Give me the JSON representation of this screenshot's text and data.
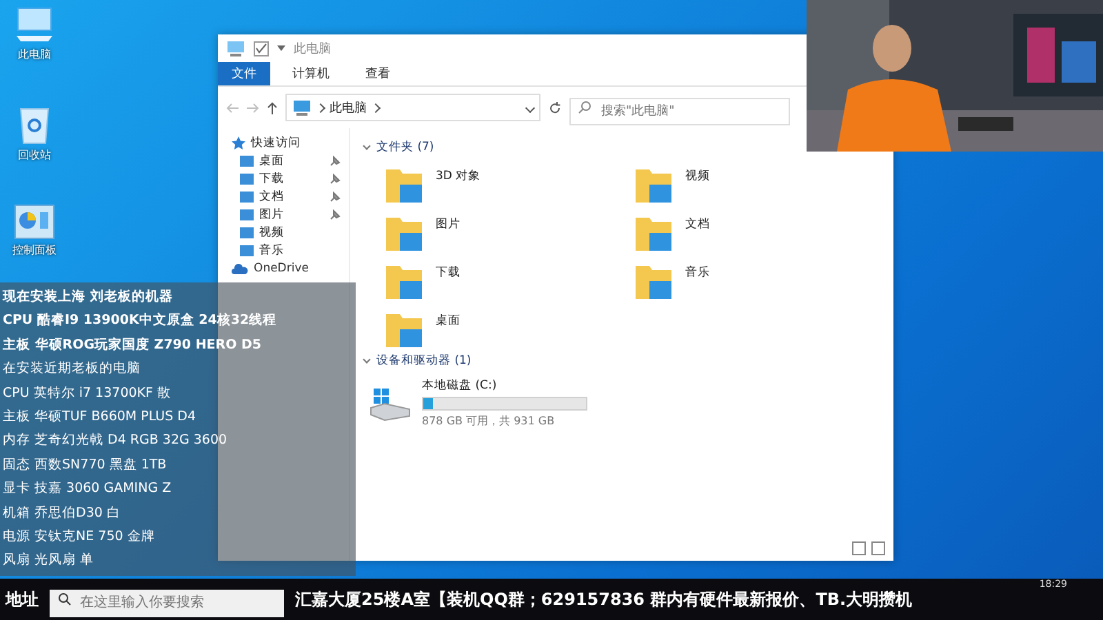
{
  "desktop_icons": [
    {
      "label": "此电脑"
    },
    {
      "label": "回收站"
    },
    {
      "label": "控制面板"
    }
  ],
  "explorer": {
    "title": "此电脑",
    "ribbon_tabs": [
      {
        "label": "文件",
        "selected": true
      },
      {
        "label": "计算机",
        "selected": false
      },
      {
        "label": "查看",
        "selected": false
      }
    ],
    "address": "此电脑",
    "search": {
      "placeholder": "搜索\"此电脑\""
    },
    "sidebar": {
      "quick_access": "快速访问",
      "items": [
        {
          "label": "桌面",
          "pinned": true
        },
        {
          "label": "下载",
          "pinned": true
        },
        {
          "label": "文档",
          "pinned": true
        },
        {
          "label": "图片",
          "pinned": true
        },
        {
          "label": "视频",
          "pinned": false
        },
        {
          "label": "音乐",
          "pinned": false
        }
      ],
      "onedrive": "OneDrive"
    },
    "folders_header": "文件夹 (7)",
    "folders": [
      {
        "label": "3D 对象"
      },
      {
        "label": "视频"
      },
      {
        "label": "图片"
      },
      {
        "label": "文档"
      },
      {
        "label": "下载"
      },
      {
        "label": "音乐"
      },
      {
        "label": "桌面"
      }
    ],
    "devices_header": "设备和驱动器 (1)",
    "drive": {
      "name": "本地磁盘 (C:)",
      "level": 0.06,
      "reading": "878 GB 可用，共 931 GB"
    }
  },
  "overlay": {
    "lines": [
      "现在安装上海  刘老板的机器",
      "CPU 酷睿I9 13900K中文原盒 24核32线程",
      "主板 华硕ROG玩家国度  Z790 HERO D5",
      "在安装近期老板的电脑",
      "CPU 英特尔 i7 13700KF 散",
      "主板 华硕TUF B660M PLUS D4",
      "内存 芝奇幻光戟 D4 RGB 32G 3600",
      "固态 西数SN770 黑盘 1TB",
      "显卡 技嘉 3060 GAMING Z",
      "机箱 乔思伯D30 白",
      "电源 安钛克NE 750 金牌",
      "风扇 光风扇 单"
    ]
  },
  "bottom_bar": {
    "ticker_start": "地址",
    "search_placeholder": "在这里输入你要搜索",
    "ticker_end": "汇嘉大厦25楼A室【装机QQ群；629157836  群内有硬件最新报价、TB.大明攒机",
    "time": "18:29"
  }
}
